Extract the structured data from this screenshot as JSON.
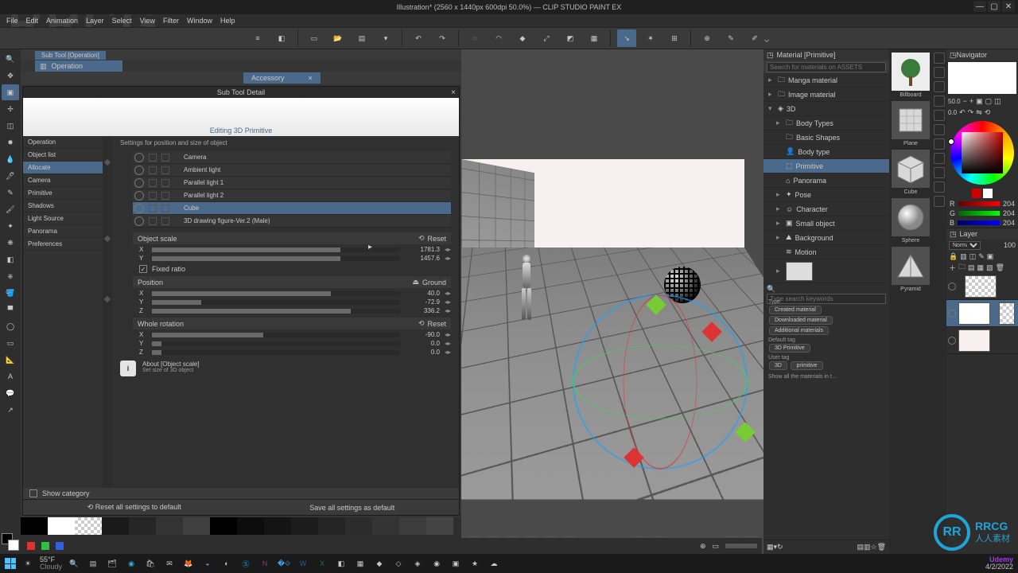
{
  "window": {
    "title": "Illustration* (2560 x 1440px 600dpi 50.0%) — CLIP STUDIO PAINT EX"
  },
  "menu": [
    "File",
    "Edit",
    "Animation",
    "Layer",
    "Select",
    "View",
    "Filter",
    "Window",
    "Help"
  ],
  "subtool": {
    "tab": "Sub Tool [Operation]",
    "selected": "Operation",
    "dropdown": "Accessory"
  },
  "dialog": {
    "title": "Sub Tool Detail",
    "banner": "Editing 3D Primitive",
    "categories": [
      "Operation",
      "Object list",
      "Allocate",
      "Camera",
      "Primitive",
      "Shadows",
      "Light Source",
      "Panorama",
      "Preferences"
    ],
    "sel_cat": "Allocate",
    "hint": "Settings for position and size of object",
    "scene": [
      {
        "name": "Camera"
      },
      {
        "name": "Ambient light"
      },
      {
        "name": "Parallel light 1"
      },
      {
        "name": "Parallel light 2"
      },
      {
        "name": "Cube",
        "sel": true
      },
      {
        "name": "3D drawing figure-Ver.2 (Male)"
      }
    ],
    "object_scale": {
      "label": "Object scale",
      "reset": "Reset",
      "x": {
        "val": "1781.3",
        "fill": 76
      },
      "y": {
        "val": "1457.6",
        "fill": 76
      },
      "fixed": "Fixed ratio"
    },
    "position": {
      "label": "Position",
      "ground": "Ground",
      "x": {
        "val": "40.0",
        "fill": 72
      },
      "y": {
        "val": "-72.9",
        "fill": 20
      },
      "z": {
        "val": "336.2",
        "fill": 80
      }
    },
    "rotation": {
      "label": "Whole rotation",
      "reset": "Reset",
      "x": {
        "val": "-90.0",
        "fill": 45
      },
      "y": {
        "val": "0.0",
        "fill": 4
      },
      "z": {
        "val": "0.0",
        "fill": 4
      }
    },
    "info_title": "About [Object scale]",
    "info_body": "Set size of 3D object",
    "show_category": "Show category",
    "footer_left": "Reset all settings to default",
    "footer_right": "Save all settings as default"
  },
  "material": {
    "title": "Material [Primitive]",
    "search_ph": "Search for materials on ASSETS",
    "tree": [
      {
        "t": "Manga material",
        "d": 1,
        "ar": "▸"
      },
      {
        "t": "Image material",
        "d": 1,
        "ar": "▸"
      },
      {
        "t": "3D",
        "d": 1,
        "ar": "▾",
        "open": true
      },
      {
        "t": "Body Types",
        "d": 2,
        "ar": "▸"
      },
      {
        "t": "Basic Shapes",
        "d": 2,
        "ar": ""
      },
      {
        "t": "Body type",
        "d": 2,
        "ar": "",
        "ico": "👤"
      },
      {
        "t": "Primitive",
        "d": 2,
        "ar": "",
        "sel": true,
        "ico": "⬚"
      },
      {
        "t": "Panorama",
        "d": 2,
        "ar": "",
        "ico": "⌂"
      },
      {
        "t": "Pose",
        "d": 2,
        "ar": "▸",
        "ico": "✦"
      },
      {
        "t": "Character",
        "d": 2,
        "ar": "▸",
        "ico": "☺"
      },
      {
        "t": "Small object",
        "d": 2,
        "ar": "▸",
        "ico": "▣"
      },
      {
        "t": "Background",
        "d": 2,
        "ar": "▸",
        "ico": "⛰"
      },
      {
        "t": "Motion",
        "d": 2,
        "ar": "",
        "ico": "≋"
      }
    ],
    "keyword_ph": "Type search keywords",
    "type_label": "Type",
    "type_tags": [
      "Created material",
      "Downloaded material",
      "Additional materials"
    ],
    "default_tag_label": "Default tag",
    "default_tag": "3D Primitive",
    "user_tag_label": "User tag",
    "user_tags": [
      "3D",
      "primitive"
    ],
    "show_all": "Show all the materials in t…",
    "thumbs": [
      {
        "cap": "Billboard",
        "kind": "tree"
      },
      {
        "cap": "Plane",
        "kind": "plane"
      },
      {
        "cap": "Cube",
        "kind": "cube"
      },
      {
        "cap": "Sphere",
        "kind": "sphere"
      },
      {
        "cap": "Pyramid",
        "kind": "pyramid"
      }
    ]
  },
  "navigator": {
    "title": "Navigator",
    "zoom": "50.0",
    "angle": "0.0",
    "rgb": {
      "r": "204",
      "g": "204",
      "b": "204"
    }
  },
  "layer": {
    "title": "Layer",
    "blend": "Normal",
    "opacity": "100"
  },
  "swatches": [
    "#000000",
    "#ffffff",
    "checker",
    "#1a1a1a",
    "#262626",
    "#333333",
    "#404040",
    "#000000",
    "#0d0d0d",
    "#141414",
    "#1c1c1c",
    "#242424",
    "#2c2c2c",
    "#343434",
    "#3c3c3c",
    "#444444"
  ],
  "buildbar": {
    "colors": [
      "#e03030",
      "#30c040",
      "#3060e0"
    ]
  },
  "taskbar": {
    "temp": "55°F",
    "cond": "Cloudy",
    "time": "",
    "date": "4/2/2022",
    "udemy": "Udemy"
  },
  "brand": {
    "logo": "RR",
    "text": "RRCG",
    "sub": "人人素材"
  }
}
